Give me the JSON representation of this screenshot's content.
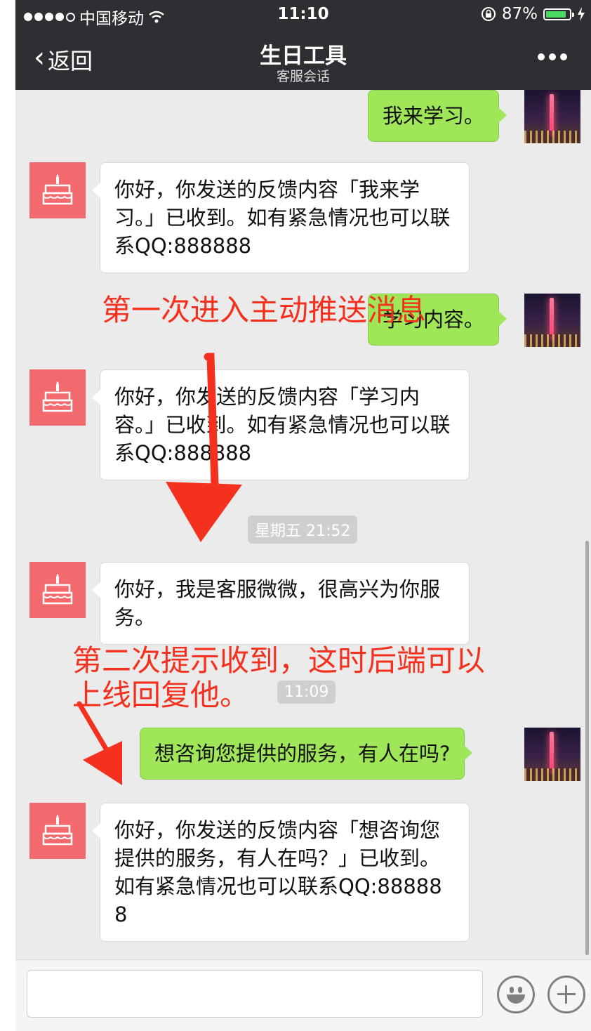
{
  "status_bar": {
    "carrier": "中国移动",
    "time": "11:10",
    "battery_percent_text": "87%",
    "battery_level": 0.87,
    "icons": [
      "signal-dots-icon",
      "wifi-icon",
      "orientation-lock-icon",
      "battery-icon",
      "charging-bolt-icon"
    ]
  },
  "nav": {
    "back_label": "返回",
    "title": "生日工具",
    "subtitle": "客服会话",
    "more_icon": "more-dots-icon"
  },
  "messages": [
    {
      "side": "right",
      "text": "我来学习。"
    },
    {
      "side": "left",
      "text": "你好，你发送的反馈内容「我来学习。」已收到。如有紧急情况也可以联系QQ:888888"
    },
    {
      "side": "right",
      "text": "学习内容。"
    },
    {
      "side": "left",
      "text": "你好，你发送的反馈内容「学习内容。」已收到。如有紧急情况也可以联系QQ:888888"
    },
    {
      "side": "time",
      "text": "星期五 21:52"
    },
    {
      "side": "left",
      "text": "你好，我是客服微微，很高兴为你服务。"
    },
    {
      "side": "time",
      "text": "11:09"
    },
    {
      "side": "right",
      "text": "想咨询您提供的服务，有人在吗?"
    },
    {
      "side": "left",
      "text": "你好，你发送的反馈内容「想咨询您提供的服务，有人在吗？」已收到。如有紧急情况也可以联系QQ:888888"
    }
  ],
  "annotations": {
    "first": "第一次进入主动推送消息",
    "second_line1": "第二次提示收到，这时后端可以",
    "second_line2": "上线回复他。"
  },
  "input_bar": {
    "input_value": "",
    "emoji_icon": "emoji-icon",
    "plus_icon": "plus-icon"
  },
  "colors": {
    "nav_bg": "#2e2e33",
    "chat_bg": "#ebebeb",
    "bubble_sent": "#9fe658",
    "bubble_received": "#ffffff",
    "bot_avatar": "#f26a6e",
    "annotation": "#f4301e"
  }
}
